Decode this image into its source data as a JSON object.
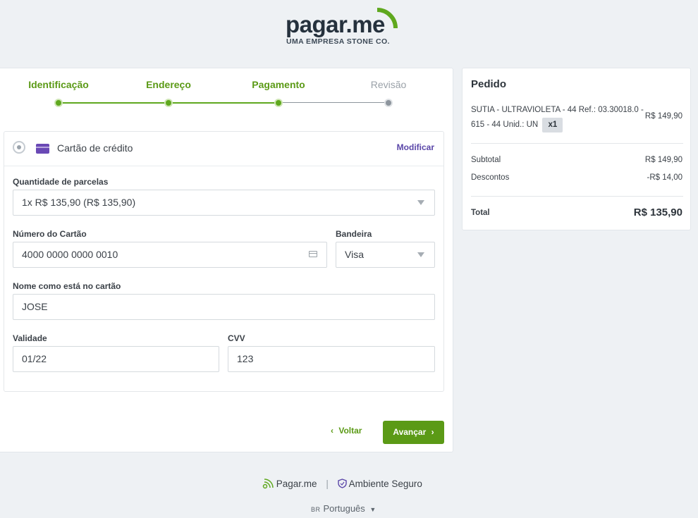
{
  "brand": {
    "name": "pagar.me",
    "tagline": "UMA EMPRESA STONE CO.",
    "accent": "#5fa81e"
  },
  "steps": [
    {
      "label": "Identificação",
      "state": "done"
    },
    {
      "label": "Endereço",
      "state": "done"
    },
    {
      "label": "Pagamento",
      "state": "current"
    },
    {
      "label": "Revisão",
      "state": "todo"
    }
  ],
  "payment": {
    "method_label": "Cartão de crédito",
    "method_icon": "credit-card-icon",
    "modify_label": "Modificar",
    "installments": {
      "label": "Quantidade de parcelas",
      "value": "1x R$ 135,90 (R$ 135,90)"
    },
    "card_number": {
      "label": "Número do Cartão",
      "value": "4000 0000 0000 0010"
    },
    "brand": {
      "label": "Bandeira",
      "value": "Visa"
    },
    "name": {
      "label": "Nome como está no cartão",
      "value": "JOSE"
    },
    "expiry": {
      "label": "Validade",
      "value": "01/22"
    },
    "cvv": {
      "label": "CVV",
      "value": "123"
    }
  },
  "actions": {
    "back": "Voltar",
    "next": "Avançar",
    "back_icon": "‹",
    "next_icon": "›"
  },
  "order": {
    "title": "Pedido",
    "item": {
      "desc": "SUTIA - ULTRAVIOLETA - 44 Ref.: 03.30018.0 - 615 - 44 Unid.: UN",
      "qty": "x1",
      "price": "R$ 149,90"
    },
    "subtotal": {
      "label": "Subtotal",
      "value": "R$ 149,90"
    },
    "discounts": {
      "label": "Descontos",
      "value": "-R$ 14,00"
    },
    "total": {
      "label": "Total",
      "value": "R$ 135,90"
    }
  },
  "footer": {
    "brand": "Pagar.me",
    "secure": "Ambiente Seguro",
    "separator": "|",
    "lang_code": "BR",
    "lang": "Português"
  }
}
